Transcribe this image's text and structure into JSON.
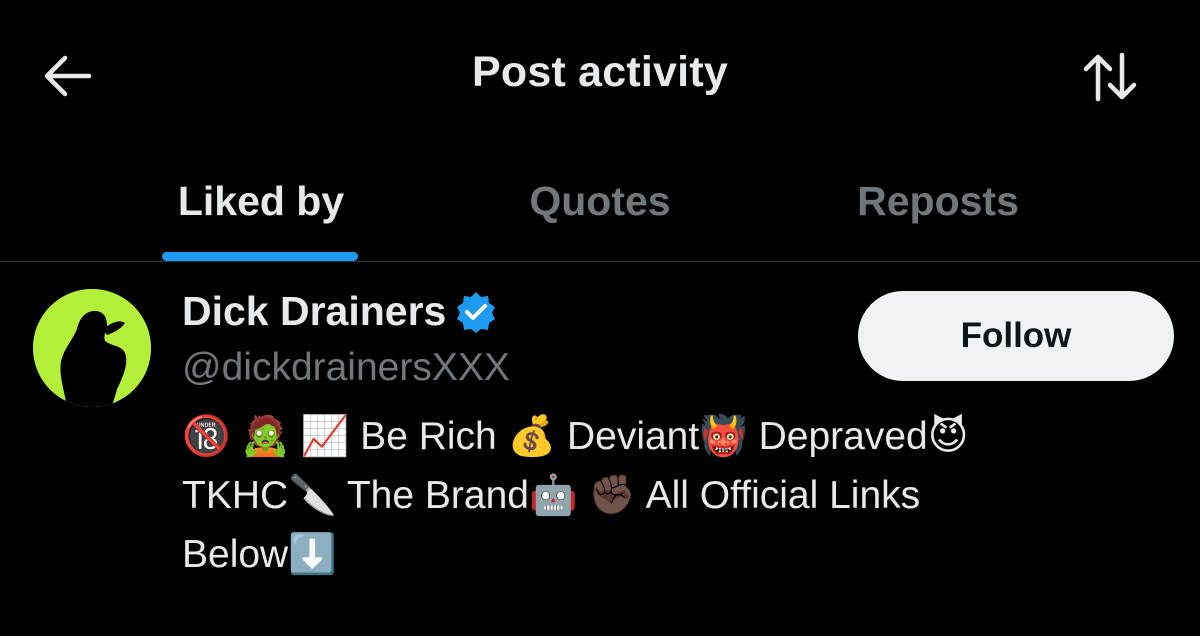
{
  "header": {
    "title": "Post activity",
    "back_icon": "arrow-left-icon",
    "sort_icon": "sort-arrows-icon"
  },
  "tabs": [
    {
      "label": "Liked by",
      "active": true
    },
    {
      "label": "Quotes",
      "active": false
    },
    {
      "label": "Reposts",
      "active": false
    }
  ],
  "user": {
    "name": "Dick Drainers",
    "verified": true,
    "handle": "@dickdrainersXXX",
    "follow_label": "Follow",
    "bio_lines": [
      "🔞 🧟 📈 Be Rich 💰 Deviant👹 Depraved😈",
      "TKHC🔪 The Brand🤖 ✊🏿 All Official Links",
      "Below⬇️"
    ]
  },
  "colors": {
    "background": "#000000",
    "text_primary": "#e7e9ea",
    "text_secondary": "#71767b",
    "accent": "#1d9bf0",
    "divider": "#2f3336",
    "follow_bg": "#eff3f4",
    "avatar_bg": "#b4f03a"
  }
}
